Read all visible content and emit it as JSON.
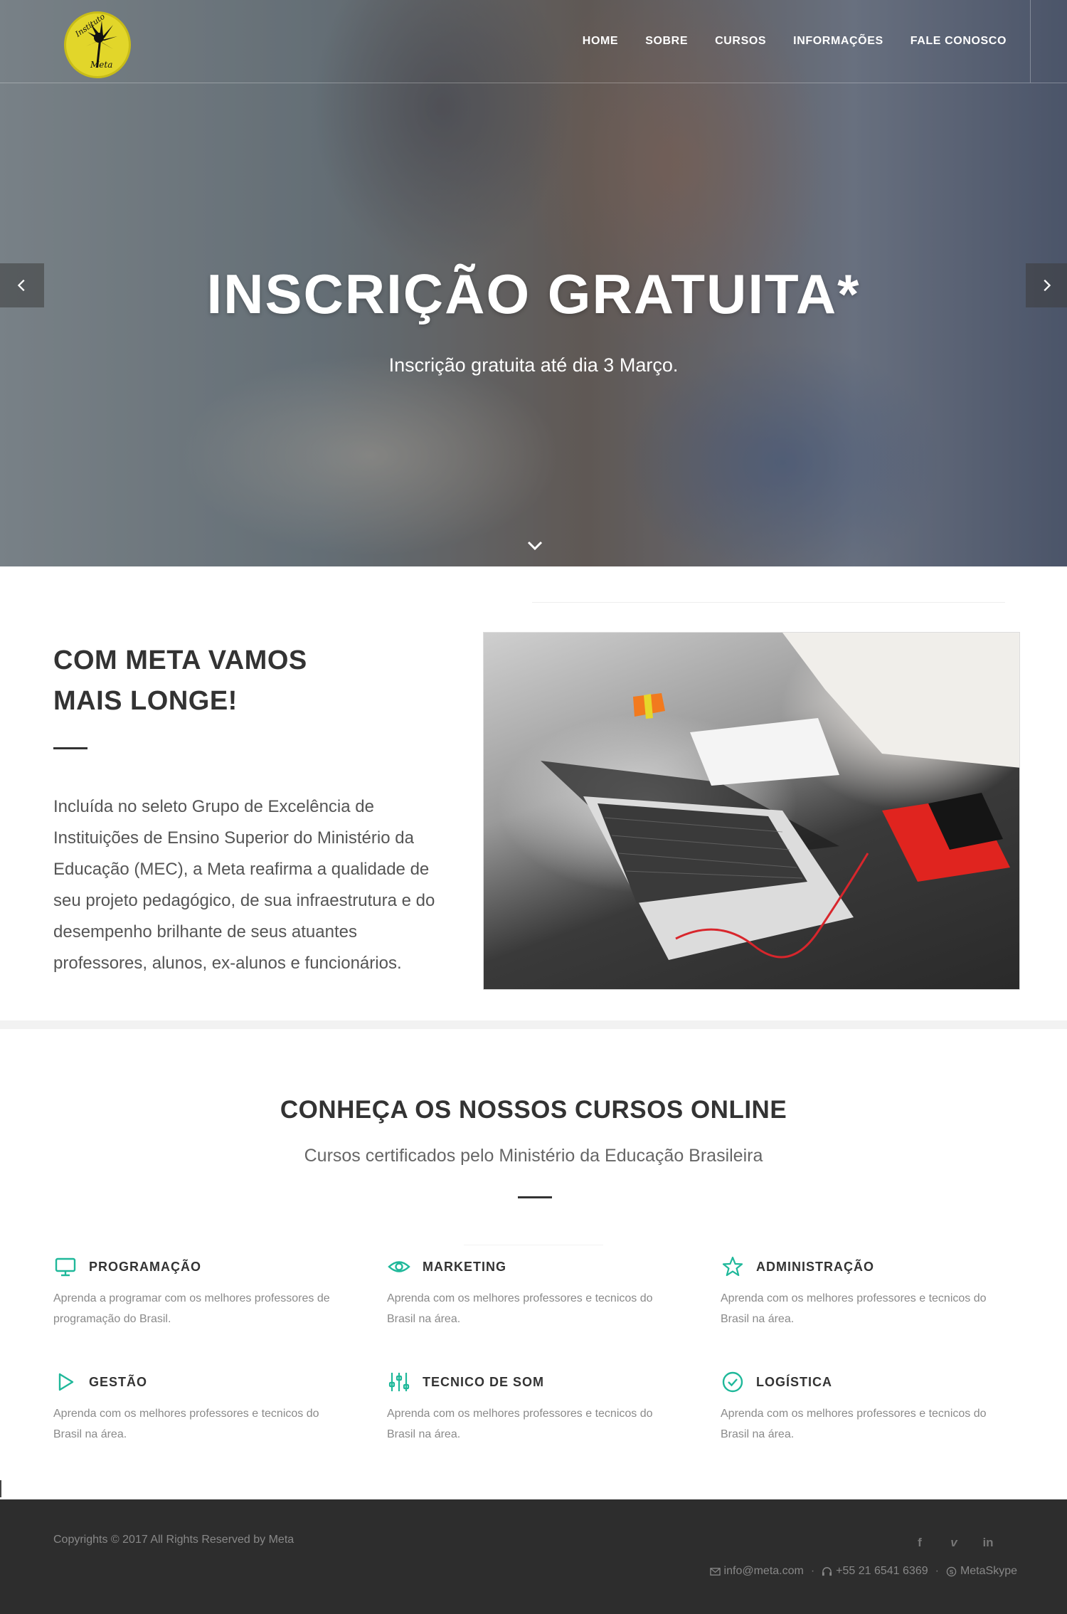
{
  "brand": {
    "logo_top_text": "Instituto",
    "logo_bottom_text": "Meta"
  },
  "nav": {
    "items": [
      "HOME",
      "SOBRE",
      "CURSOS",
      "INFORMAÇÕES",
      "FALE CONOSCO"
    ]
  },
  "hero": {
    "title": "INSCRIÇÃO GRATUITA*",
    "subtitle": "Inscrição gratuita até dia 3 Março.",
    "prev_icon": "chevron-left-icon",
    "next_icon": "chevron-right-icon",
    "scroll_icon": "chevron-down-icon"
  },
  "about": {
    "title_line1": "COM META VAMOS",
    "title_line2": "MAIS LONGE!",
    "text": "Incluída no seleto Grupo de Excelência de Instituições de Ensino Superior do Ministério da Educação (MEC), a Meta reafirma a qualidade de seu projeto pedagógico, de sua infraestrutura e do desempenho brilhante de seus atuantes professores, alunos, ex-alunos e funcionários."
  },
  "courses": {
    "title": "CONHEÇA OS NOSSOS CURSOS ONLINE",
    "subtitle": "Cursos certificados pelo Ministério da Educação Brasileira",
    "accent_color": "#1fb89a",
    "items": [
      {
        "title": "PROGRAMAÇÃO",
        "icon": "monitor-icon",
        "desc": "Aprenda a programar com os melhores professores de programação do Brasil."
      },
      {
        "title": "MARKETING",
        "icon": "eye-icon",
        "desc": "Aprenda com os melhores professores e tecnicos do Brasil na área."
      },
      {
        "title": "ADMINISTRAÇÃO",
        "icon": "star-icon",
        "desc": "Aprenda com os melhores professores e tecnicos do Brasil na área."
      },
      {
        "title": "GESTÃO",
        "icon": "play-icon",
        "desc": "Aprenda com os melhores professores e tecnicos do Brasil na área."
      },
      {
        "title": "TECNICO DE SOM",
        "icon": "sliders-icon",
        "desc": "Aprenda com os melhores professores e tecnicos do Brasil na área."
      },
      {
        "title": "LOGÍSTICA",
        "icon": "check-circle-icon",
        "desc": "Aprenda com os melhores professores e tecnicos do Brasil na área."
      }
    ]
  },
  "footer": {
    "copyright": "Copyrights © 2017 All Rights Reserved by Meta",
    "social": [
      {
        "icon": "facebook-icon",
        "glyph": "f"
      },
      {
        "icon": "vimeo-icon",
        "glyph": "v"
      },
      {
        "icon": "linkedin-icon",
        "glyph": "in"
      }
    ],
    "email": "info@meta.com",
    "phone": "+55 21 6541 6369",
    "skype": "MetaSkype"
  }
}
